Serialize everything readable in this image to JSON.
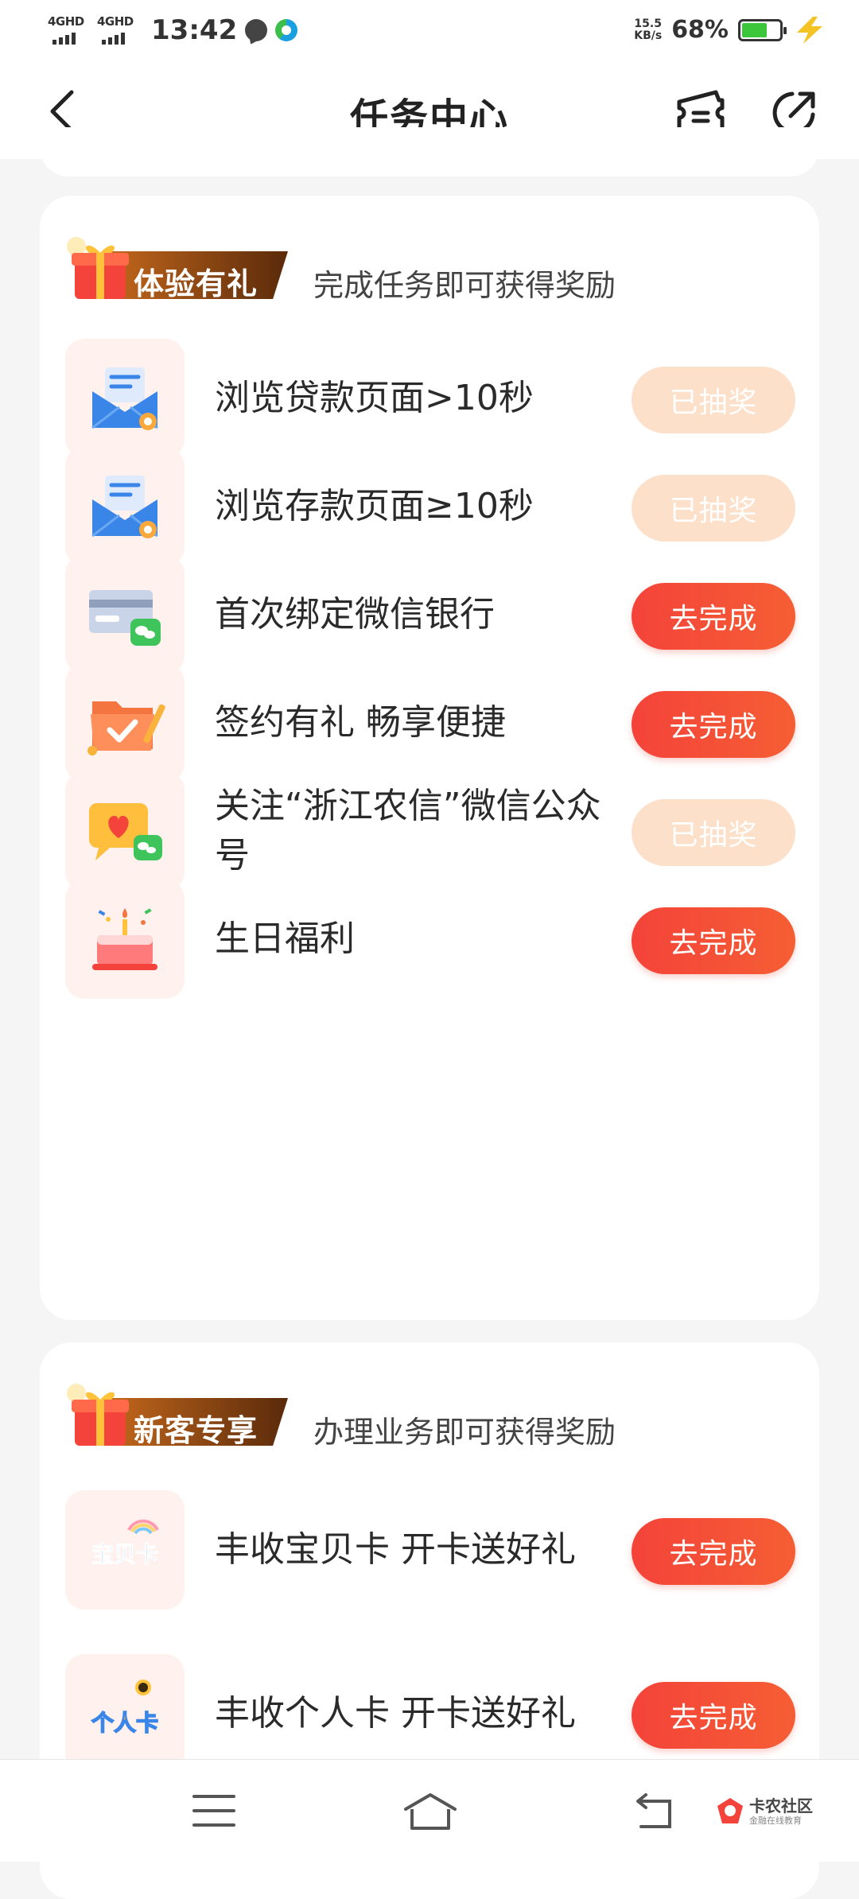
{
  "status_bar": {
    "network_1": "4GHD",
    "network_2": "4GHD",
    "time": "13:42",
    "speed_value": "15.5",
    "speed_unit": "KB/s",
    "battery": "68%",
    "battery_level": 0.68
  },
  "header": {
    "title": "任务中心"
  },
  "sections": [
    {
      "tag": "体验有礼",
      "subtitle": "完成任务即可获得奖励",
      "tasks": [
        {
          "label": "浏览贷款页面>10秒",
          "button": "已抽奖",
          "icon": "mail-envelope-icon"
        },
        {
          "label": "浏览存款页面≥10秒",
          "button": "已抽奖",
          "icon": "mail-envelope-icon"
        },
        {
          "label": "首次绑定微信银行",
          "button": "去完成",
          "icon": "bank-card-wechat-icon"
        },
        {
          "label": "签约有礼 畅享便捷",
          "button": "去完成",
          "icon": "folder-check-icon"
        },
        {
          "label": "关注“浙江农信”微信公众号",
          "button": "已抽奖",
          "icon": "heart-chat-icon"
        },
        {
          "label": "生日福利",
          "button": "去完成",
          "icon": "birthday-cake-icon"
        }
      ]
    },
    {
      "tag": "新客专享",
      "subtitle": "办理业务即可获得奖励",
      "tasks": [
        {
          "label": "丰收宝贝卡 开卡送好礼",
          "button": "去完成",
          "icon": "baby-card-icon",
          "icon_text": "宝贝卡"
        },
        {
          "label": "丰收个人卡 开卡送好礼",
          "button": "去完成",
          "icon": "personal-card-icon",
          "icon_text": "个人卡"
        }
      ]
    }
  ],
  "watermark": {
    "text": "卡农社区",
    "sub": "金融在线教育"
  },
  "colors": {
    "accent": "#f4433a",
    "done_button": "#fde0c9",
    "tag_start": "#c86a1d",
    "tag_end": "#5a2a0a"
  }
}
